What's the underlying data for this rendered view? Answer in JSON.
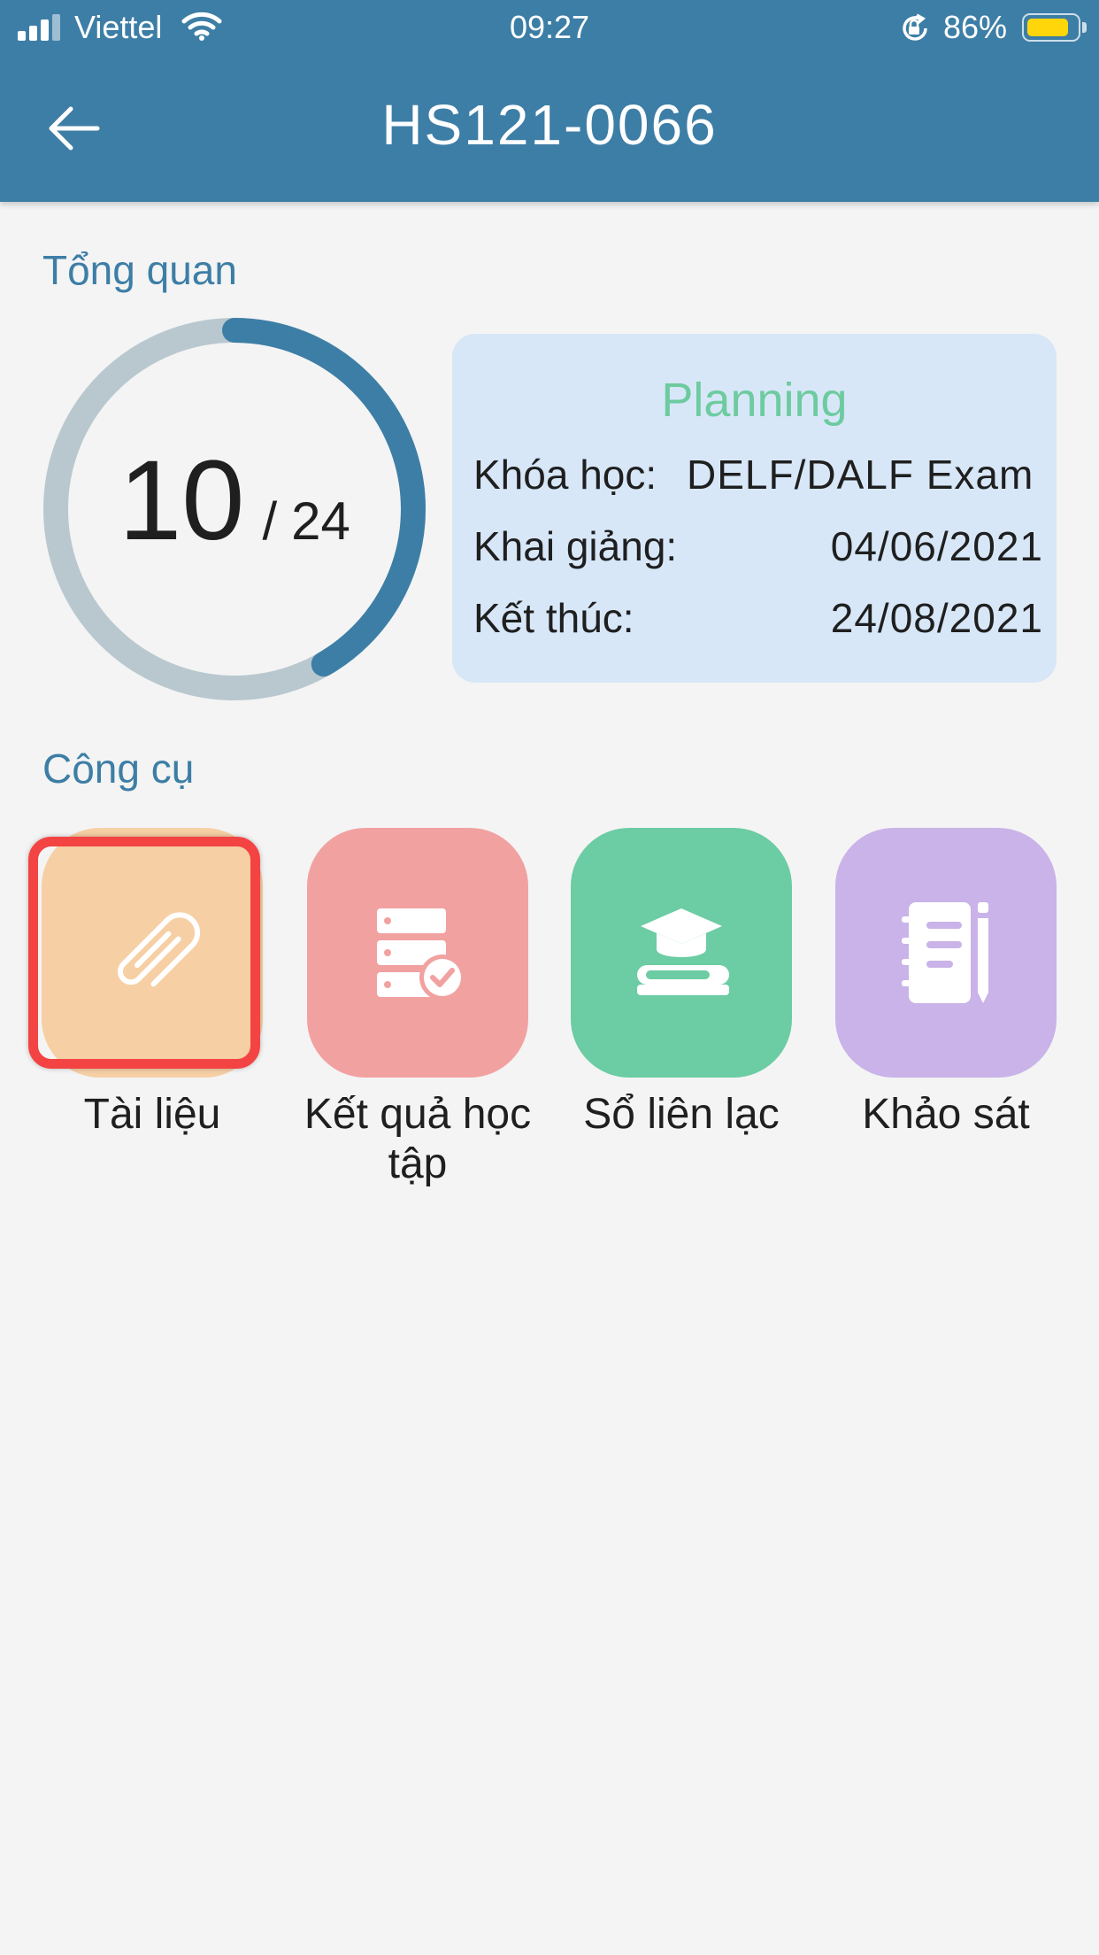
{
  "status_bar": {
    "carrier": "Viettel",
    "time": "09:27",
    "battery_percent": "86%",
    "battery_level": 0.86
  },
  "header": {
    "title": "HS121-0066"
  },
  "overview": {
    "section_title": "Tổng quan",
    "progress": {
      "done": "10",
      "separator": "/",
      "total": "24",
      "fraction": 0.4167
    },
    "card": {
      "status": "Planning",
      "course_label": "Khóa học:",
      "course_value": "DELF/DALF Exam",
      "start_label": "Khai giảng:",
      "start_value": "04/06/2021",
      "end_label": "Kết thúc:",
      "end_value": "24/08/2021"
    }
  },
  "tools": {
    "section_title": "Công cụ",
    "items": [
      {
        "label": "Tài liệu",
        "icon": "paperclip-icon",
        "color": "#f6cfa4",
        "highlighted": true
      },
      {
        "label": "Kết quả học tập",
        "icon": "checklist-icon",
        "color": "#f2a1a1"
      },
      {
        "label": "Sổ liên lạc",
        "icon": "graduation-book-icon",
        "color": "#6ccca3"
      },
      {
        "label": "Khảo sát",
        "icon": "notebook-icon",
        "color": "#c9b3e8"
      }
    ]
  },
  "colors": {
    "primary": "#3d7ea6",
    "ring_track": "#b9c8cf",
    "planning": "#6dcb9f",
    "highlight": "#f34343"
  }
}
